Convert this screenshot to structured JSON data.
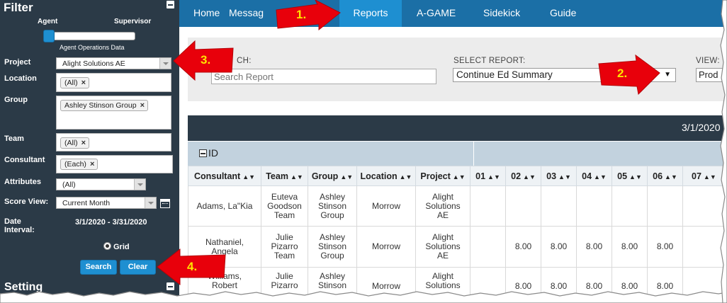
{
  "sidebar": {
    "filter_title": "Filter",
    "slider": {
      "left_label": "Agent",
      "right_label": "Supervisor",
      "caption": "Agent Operations Data"
    },
    "fields": {
      "project": {
        "label": "Project",
        "value": "Alight Solutions AE"
      },
      "location": {
        "label": "Location",
        "tags": [
          "(All)"
        ]
      },
      "group": {
        "label": "Group",
        "tags": [
          "Ashley Stinson Group"
        ]
      },
      "team": {
        "label": "Team",
        "tags": [
          "(All)"
        ]
      },
      "consultant": {
        "label": "Consultant",
        "tags": [
          "(Each)"
        ]
      },
      "attributes": {
        "label": "Attributes",
        "value": "(All)"
      },
      "score_view": {
        "label": "Score View:",
        "value": "Current Month"
      },
      "date_interval": {
        "label_line1": "Date",
        "label_line2": "Interval:",
        "value": "3/1/2020 - 3/31/2020"
      }
    },
    "grid_option": "Grid",
    "search_button": "Search",
    "clear_button": "Clear",
    "settings_title": "Setting"
  },
  "nav": {
    "items": [
      "Home",
      "Messag",
      "Reports",
      "A-GAME",
      "Sidekick",
      "Guide"
    ],
    "active": "Reports"
  },
  "report_panel": {
    "search_label": "CH:",
    "search_placeholder": "Search Report",
    "select_label": "SELECT REPORT:",
    "select_value": "Continue Ed Summary",
    "view_label": "VIEW:",
    "view_value": "Prod"
  },
  "grid": {
    "header_date": "3/1/2020",
    "id_label": "ID",
    "columns": [
      "Consultant",
      "Team",
      "Group",
      "Location",
      "Project",
      "01",
      "02",
      "03",
      "04",
      "05",
      "06",
      "07"
    ],
    "rows": [
      {
        "consultant": [
          "Adams, La\"Kia"
        ],
        "team": [
          "Euteva",
          "Goodson",
          "Team"
        ],
        "group": [
          "Ashley",
          "Stinson",
          "Group"
        ],
        "location": "Morrow",
        "project": [
          "Alight",
          "Solutions",
          "AE"
        ],
        "days": [
          "",
          "",
          "",
          "",
          "",
          "",
          ""
        ]
      },
      {
        "consultant": [
          "Nathaniel,",
          "Angela"
        ],
        "team": [
          "Julie",
          "Pizarro",
          "Team"
        ],
        "group": [
          "Ashley",
          "Stinson",
          "Group"
        ],
        "location": "Morrow",
        "project": [
          "Alight",
          "Solutions",
          "AE"
        ],
        "days": [
          "",
          "8.00",
          "8.00",
          "8.00",
          "8.00",
          "8.00",
          ""
        ]
      },
      {
        "consultant": [
          "Williams,",
          "Robert"
        ],
        "team": [
          "Julie",
          "Pizarro"
        ],
        "group": [
          "Ashley",
          "Stinson"
        ],
        "location": "Morrow",
        "project": [
          "Alight",
          "Solutions"
        ],
        "days": [
          "",
          "8.00",
          "8.00",
          "8.00",
          "8.00",
          "8.00",
          ""
        ]
      }
    ]
  },
  "callouts": [
    "1.",
    "2.",
    "3.",
    "4."
  ],
  "colors": {
    "sidebar_bg": "#2b3a47",
    "nav_bg": "#1b6fa6",
    "nav_active": "#1e8fd1",
    "callout_arrow": "#e8000b",
    "callout_text": "#ffe400"
  }
}
